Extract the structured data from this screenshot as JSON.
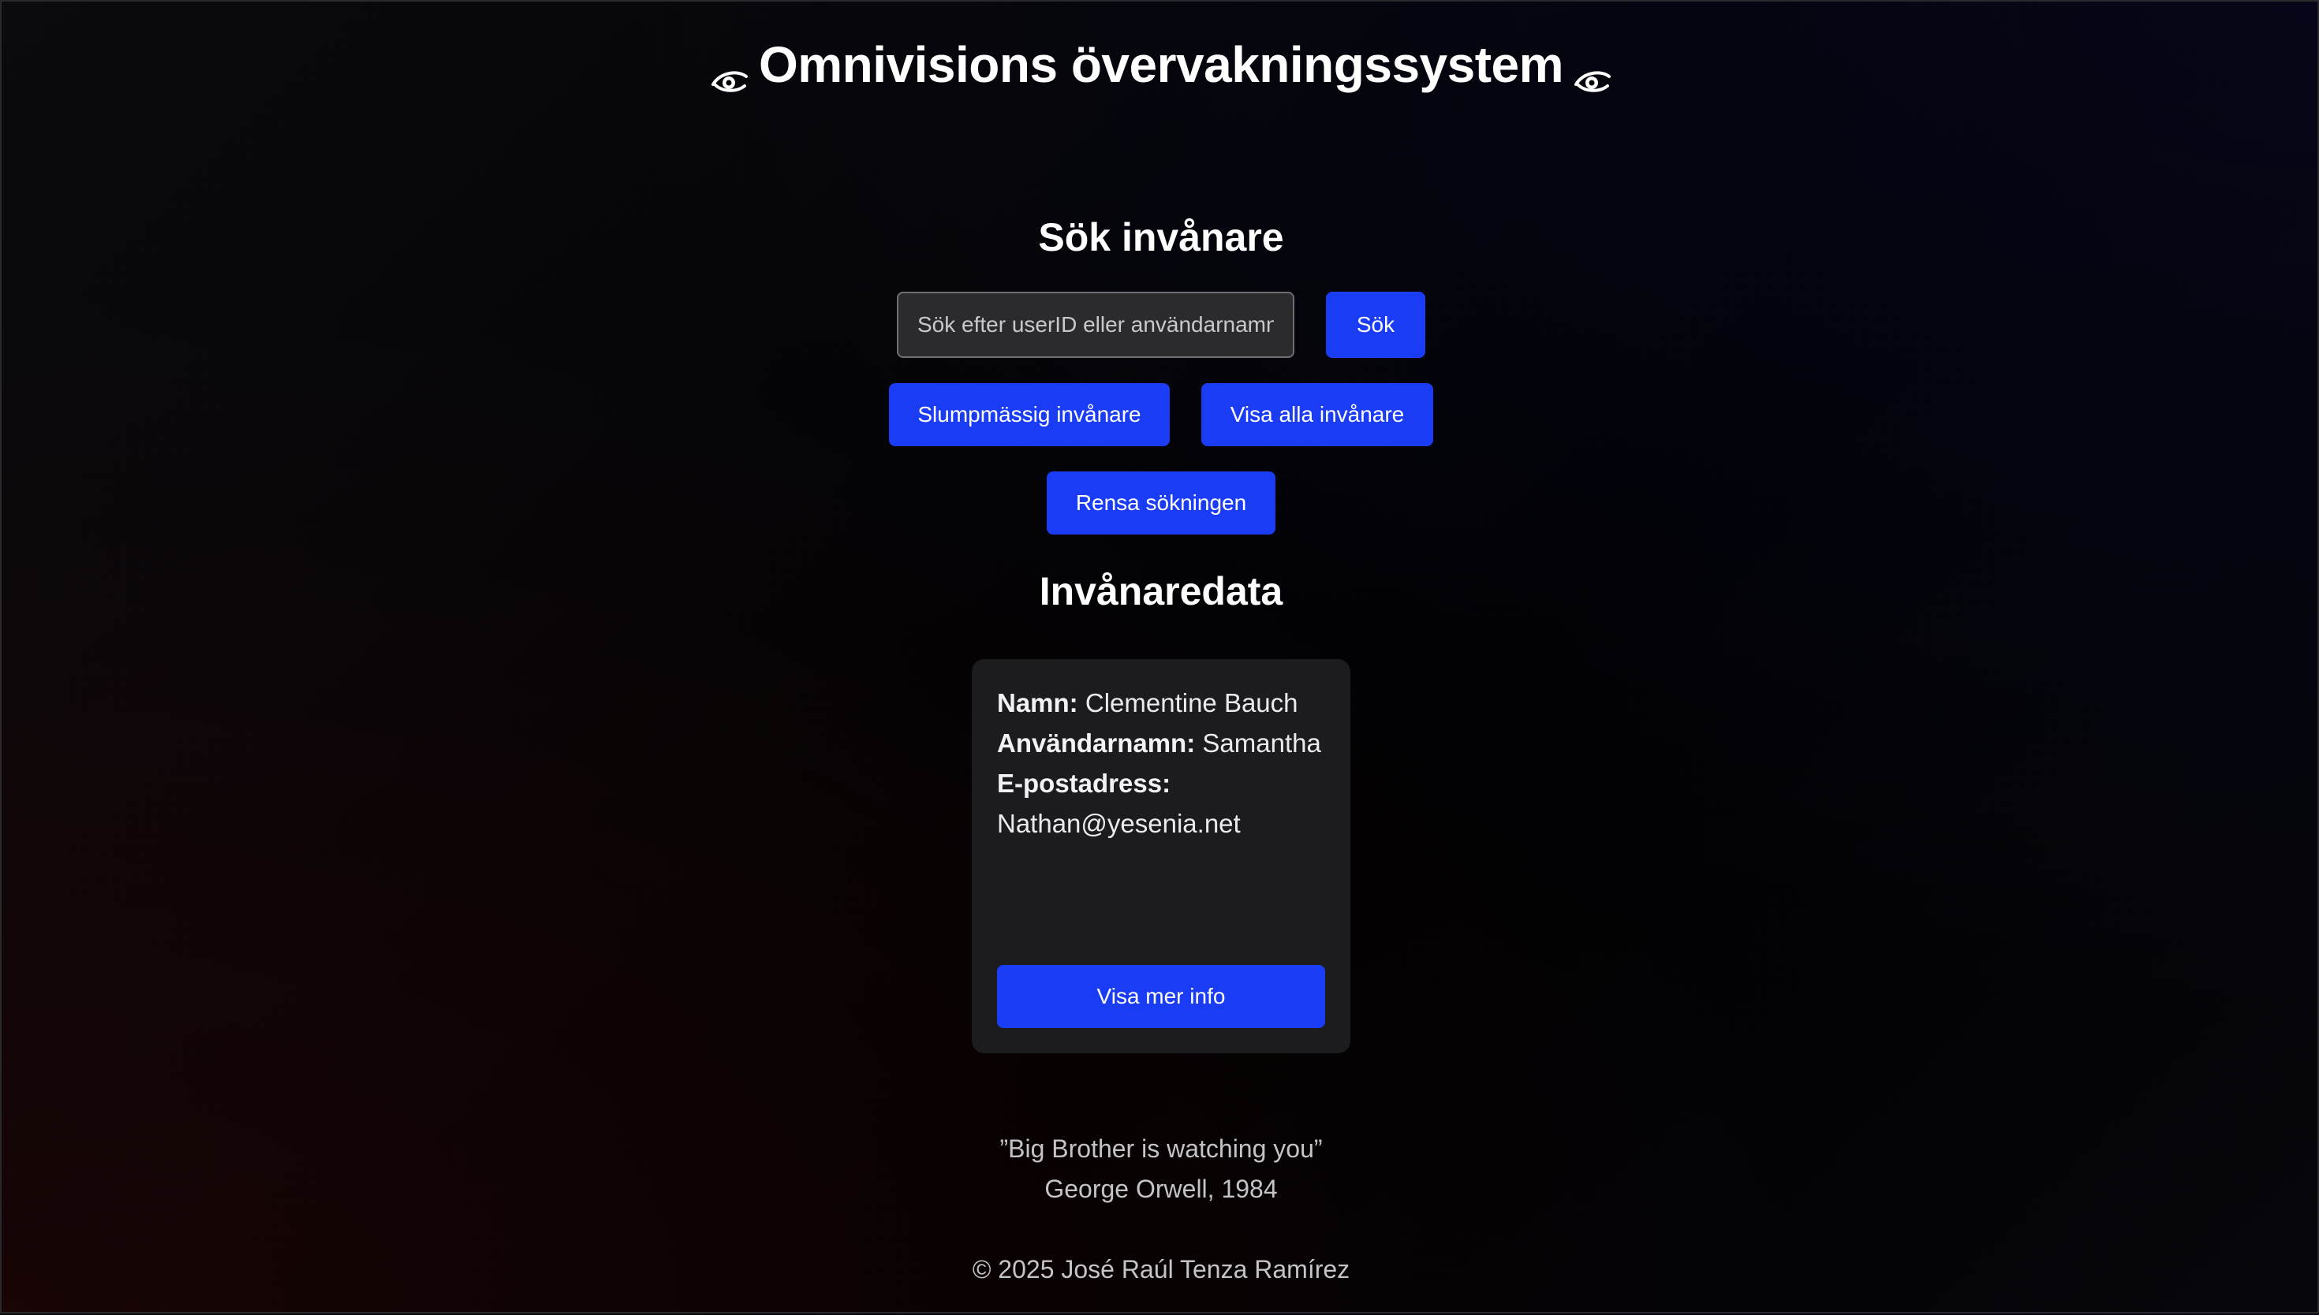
{
  "header": {
    "title": "Omnivisions övervakningssystem",
    "left_icon": "eye-icon",
    "right_icon": "eye-icon"
  },
  "search": {
    "heading": "Sök invånare",
    "placeholder": "Sök efter userID eller användarnamn",
    "value": "",
    "search_label": "Sök",
    "random_label": "Slumpmässig invånare",
    "show_all_label": "Visa alla invånare",
    "clear_label": "Rensa sökningen"
  },
  "results": {
    "heading": "Invånaredata",
    "card": {
      "name_label": "Namn:",
      "name_value": "Clementine Bauch",
      "username_label": "Användarnamn:",
      "username_value": "Samantha",
      "email_label": "E-postadress:",
      "email_value": "Nathan@yesenia.net",
      "more_label": "Visa mer info"
    }
  },
  "quote": {
    "text": "”Big Brother is watching you”",
    "attribution": "George Orwell, 1984"
  },
  "footer": {
    "copyright": "© 2025 José Raúl Tenza Ramírez"
  },
  "colors": {
    "accent": "#1a3cf5",
    "card_bg": "#1c1c1e",
    "page_bg": "#000000"
  }
}
